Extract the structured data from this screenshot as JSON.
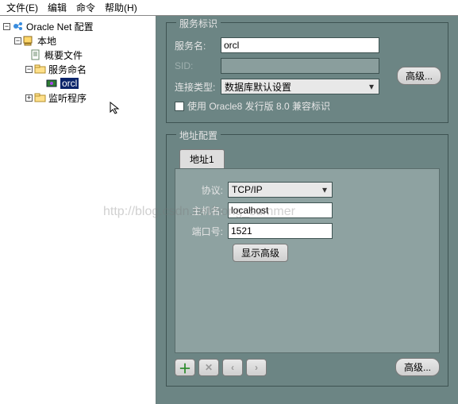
{
  "menu": {
    "file": "文件(E)",
    "edit": "编辑",
    "cmd": "命令",
    "help": "帮助(H)"
  },
  "tree": {
    "root": "Oracle Net 配置",
    "local": "本地",
    "profile": "概要文件",
    "servicenames": "服务命名",
    "orcl": "orcl",
    "listeners": "监听程序"
  },
  "service": {
    "legend": "服务标识",
    "service_label": "服务名:",
    "service_value": "orcl",
    "sid_label": "SID:",
    "sid_value": "",
    "conntype_label": "连接类型:",
    "conntype_value": "数据库默认设置",
    "compat_label": "使用 Oracle8 发行版 8.0 兼容标识",
    "adv_btn": "高级..."
  },
  "address": {
    "legend": "地址配置",
    "tab1": "地址1",
    "protocol_label": "协议:",
    "protocol_value": "TCP/IP",
    "host_label": "主机名:",
    "host_value": "localhost",
    "port_label": "端口号:",
    "port_value": "1521",
    "show_adv": "显示高级",
    "adv_btn": "高级..."
  },
  "nav": {
    "add": "＋",
    "del": "✕",
    "prev": "‹",
    "next": "›"
  },
  "watermark": "http://blog.csdn.net/hong_summer"
}
